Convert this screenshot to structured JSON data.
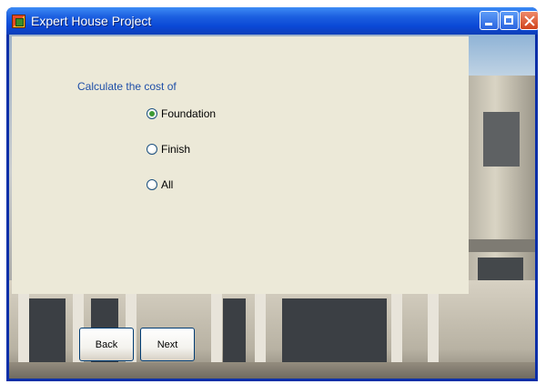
{
  "window": {
    "title": "Expert House Project"
  },
  "form": {
    "prompt": "Calculate the cost of",
    "options": [
      {
        "label": "Foundation",
        "checked": true
      },
      {
        "label": "Finish",
        "checked": false
      },
      {
        "label": "All",
        "checked": false
      }
    ],
    "back_label": "Back",
    "next_label": "Next"
  },
  "colors": {
    "titlebar": "#0a48d6",
    "panel": "#ece9d8",
    "prompt_text": "#1f4fa8"
  }
}
